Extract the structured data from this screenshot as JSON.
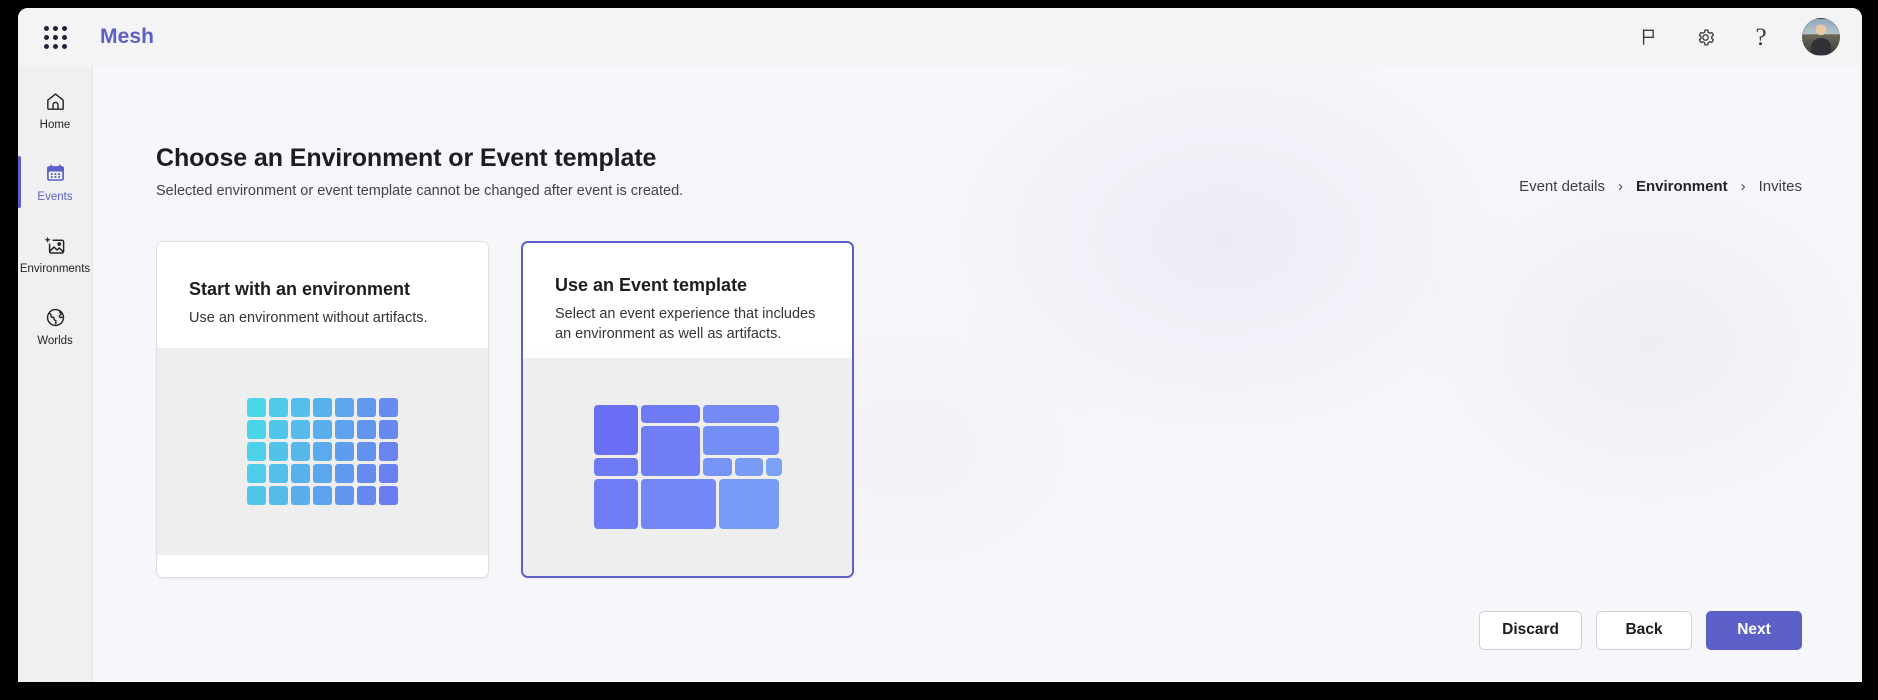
{
  "topbar": {
    "waffle_icon": "app-launcher-icon",
    "brand": "Mesh",
    "icons": [
      {
        "name": "flag-icon",
        "label": "Feedback"
      },
      {
        "name": "gear-icon",
        "label": "Settings"
      },
      {
        "name": "help-icon",
        "label": "?"
      }
    ],
    "avatar_alt": "User account"
  },
  "sidebar": {
    "items": [
      {
        "label": "Home",
        "icon": "home-icon",
        "active": false
      },
      {
        "label": "Events",
        "icon": "calendar-events-icon",
        "active": true
      },
      {
        "label": "Environments",
        "icon": "image-sparkle-icon",
        "active": false
      },
      {
        "label": "Worlds",
        "icon": "globe-icon",
        "active": false
      }
    ]
  },
  "main": {
    "title": "Choose an Environment or Event template",
    "subtitle": "Selected environment or event template cannot be changed after event is created.",
    "breadcrumb": [
      {
        "label": "Event details",
        "current": false
      },
      {
        "label": "Environment",
        "current": true
      },
      {
        "label": "Invites",
        "current": false
      }
    ],
    "breadcrumb_separator": "›",
    "cards": [
      {
        "title": "Start with an environment",
        "description": "Use an environment without artifacts.",
        "selected": false,
        "art": "grid-tiles-illustration"
      },
      {
        "title": "Use an Event template",
        "description": "Select an event experience that includes an environment as well as artifacts.",
        "selected": true,
        "art": "mosaic-tiles-illustration"
      }
    ]
  },
  "footer": {
    "buttons": [
      {
        "label": "Discard",
        "style": "secondary"
      },
      {
        "label": "Back",
        "style": "secondary"
      },
      {
        "label": "Next",
        "style": "primary"
      }
    ]
  },
  "colors": {
    "accent": "#5b5fc7",
    "page_bg": "#f7f6fa",
    "rail_bg": "#f1f0f0",
    "card_art_bg": "#efeeee",
    "grid_from": "#4ad8e8",
    "grid_to": "#6a7cf0",
    "mosaic_from": "#6a6ef5",
    "mosaic_to": "#7eb0f7"
  }
}
